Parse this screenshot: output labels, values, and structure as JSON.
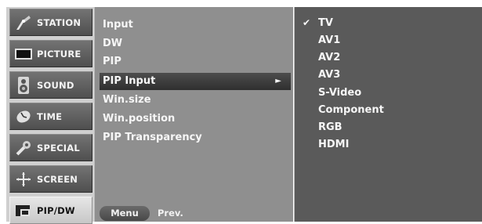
{
  "categories": [
    {
      "label": "STATION",
      "icon": "antenna-icon"
    },
    {
      "label": "PICTURE",
      "icon": "picture-screen-icon"
    },
    {
      "label": "SOUND",
      "icon": "speaker-icon"
    },
    {
      "label": "TIME",
      "icon": "clock-icon"
    },
    {
      "label": "SPECIAL",
      "icon": "special-tools-icon"
    },
    {
      "label": "SCREEN",
      "icon": "screen-adjust-icon"
    },
    {
      "label": "PIP/DW",
      "icon": "pip-window-icon",
      "active": true
    }
  ],
  "submenu": {
    "items": [
      "Input",
      "DW",
      "PIP",
      "PIP Input",
      "Win.size",
      "Win.position",
      "PIP Transparency"
    ],
    "selected": "PIP Input",
    "arrow": "►",
    "footer": {
      "menu_label": "Menu",
      "prev_label": "Prev."
    }
  },
  "options": {
    "items": [
      "TV",
      "AV1",
      "AV2",
      "AV3",
      "S-Video",
      "Component",
      "RGB",
      "HDMI"
    ],
    "checked": "TV",
    "check_mark": "✔"
  }
}
